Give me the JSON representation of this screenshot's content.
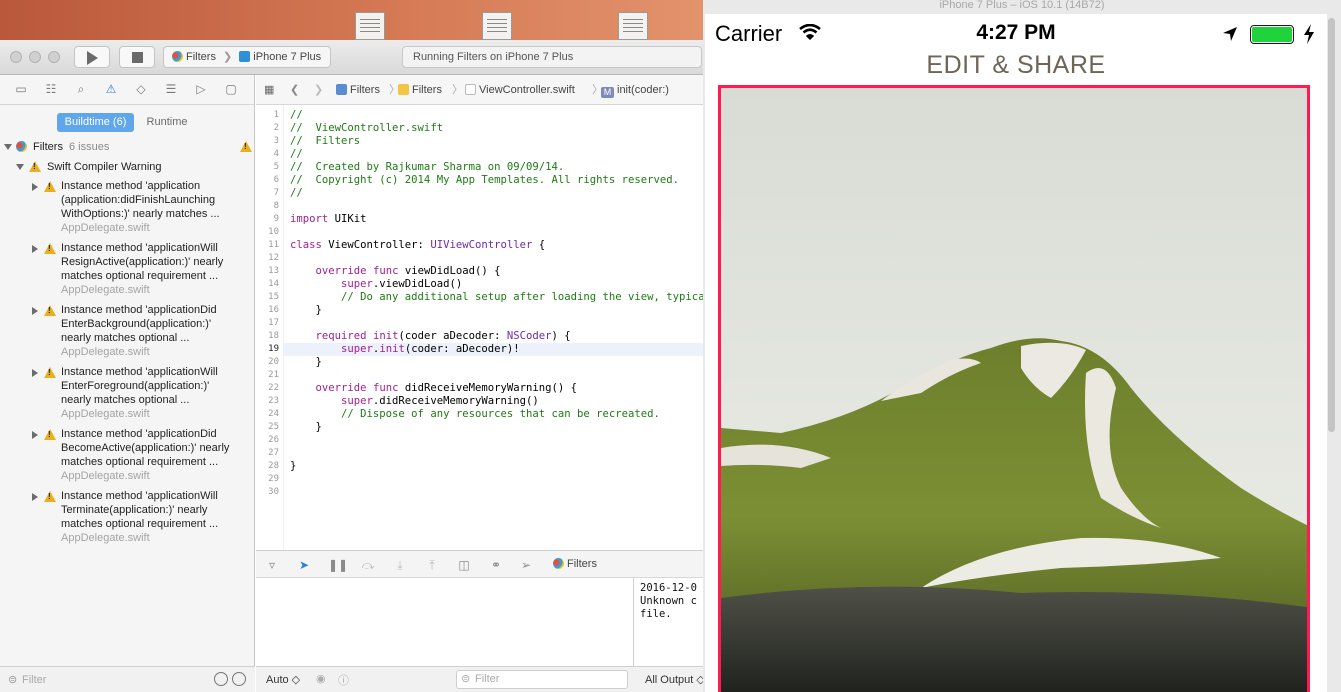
{
  "xcode": {
    "toolbar": {
      "scheme_app": "Filters",
      "scheme_device": "iPhone 7 Plus",
      "status": "Running Filters on iPhone 7 Plus"
    },
    "navigator": {
      "segments": {
        "buildtime": "Buildtime (6)",
        "runtime": "Runtime"
      },
      "project": {
        "name": "Filters",
        "count": "6 issues"
      },
      "group": "Swift Compiler Warning",
      "issues": [
        {
          "text": "Instance method 'application\n(application:didFinishLaunching\nWithOptions:)' nearly matches ...",
          "file": "AppDelegate.swift"
        },
        {
          "text": "Instance method 'applicationWill\nResignActive(application:)' nearly\nmatches optional requirement ...",
          "file": "AppDelegate.swift"
        },
        {
          "text": "Instance method 'applicationDid\nEnterBackground(application:)'\nnearly matches optional ...",
          "file": "AppDelegate.swift"
        },
        {
          "text": "Instance method 'applicationWill\nEnterForeground(application:)'\nnearly matches optional ...",
          "file": "AppDelegate.swift"
        },
        {
          "text": "Instance method 'applicationDid\nBecomeActive(application:)' nearly\nmatches optional requirement ...",
          "file": "AppDelegate.swift"
        },
        {
          "text": "Instance method 'applicationWill\nTerminate(application:)' nearly\nmatches optional requirement ...",
          "file": "AppDelegate.swift"
        }
      ],
      "filter_placeholder": "Filter"
    },
    "jumpbar": {
      "project": "Filters",
      "folder": "Filters",
      "file": "ViewController.swift",
      "symbol_badge": "M",
      "symbol": "init(coder:)"
    },
    "editor": {
      "line_numbers": [
        "1",
        "2",
        "3",
        "4",
        "5",
        "6",
        "7",
        "8",
        "9",
        "10",
        "11",
        "12",
        "13",
        "14",
        "15",
        "16",
        "17",
        "18",
        "19",
        "20",
        "21",
        "22",
        "23",
        "24",
        "25",
        "26",
        "27",
        "28",
        "29",
        "30"
      ],
      "current_line": "19",
      "lines": [
        "//",
        "//  ViewController.swift",
        "//  Filters",
        "//",
        "//  Created by Rajkumar Sharma on 09/09/14.",
        "//  Copyright (c) 2014 My App Templates. All rights reserved.",
        "//",
        "",
        "import UIKit",
        "",
        "class ViewController: UIViewController {",
        "",
        "    override func viewDidLoad() {",
        "        super.viewDidLoad()",
        "        // Do any additional setup after loading the view, typically from a nib.",
        "    }",
        "",
        "    required init(coder aDecoder: NSCoder) {",
        "        super.init(coder: aDecoder)!",
        "    }",
        "",
        "    override func didReceiveMemoryWarning() {",
        "        super.didReceiveMemoryWarning()",
        "        // Dispose of any resources that can be recreated.",
        "    }",
        "",
        "",
        "}",
        "",
        ""
      ]
    },
    "debug": {
      "target": "Filters",
      "console_lines": [
        "2016-12-0",
        "Unknown c",
        "file."
      ],
      "auto_label": "Auto ◇",
      "filter_placeholder": "Filter",
      "output_label": "All Output ◇"
    }
  },
  "simulator": {
    "window_title": "iPhone 7 Plus – iOS 10.1 (14B72)",
    "status": {
      "carrier": "Carrier",
      "time": "4:27 PM"
    },
    "title": "EDIT & SHARE",
    "accent_color": "#ff1a52"
  }
}
